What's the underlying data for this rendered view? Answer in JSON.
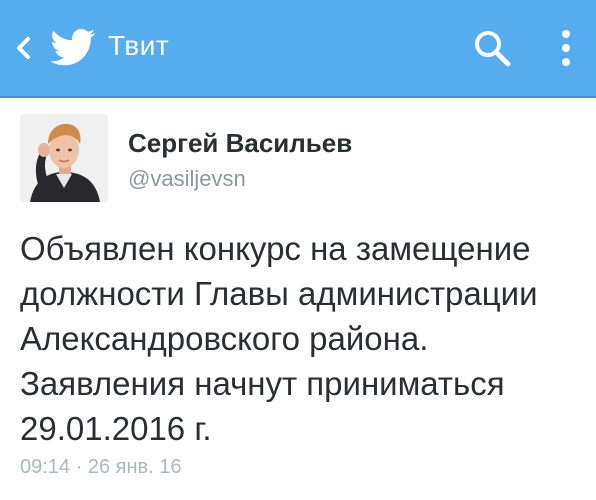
{
  "appbar": {
    "title": "Твит",
    "back_icon": "chevron-left-icon",
    "logo_icon": "twitter-bird-icon",
    "search_icon": "search-icon",
    "more_icon": "more-vertical-icon",
    "background_color": "#55acee"
  },
  "tweet": {
    "author": {
      "name": "Сергей Васильев",
      "handle": "@vasiljevsn"
    },
    "text_lines": [
      "Объявлен конкурс на замещение",
      "должности Главы администрации",
      "Александровского района.",
      "Заявления начнут приниматься",
      "29.01.2016 г."
    ],
    "timestamp": "09:14 · 26 янв. 16"
  }
}
